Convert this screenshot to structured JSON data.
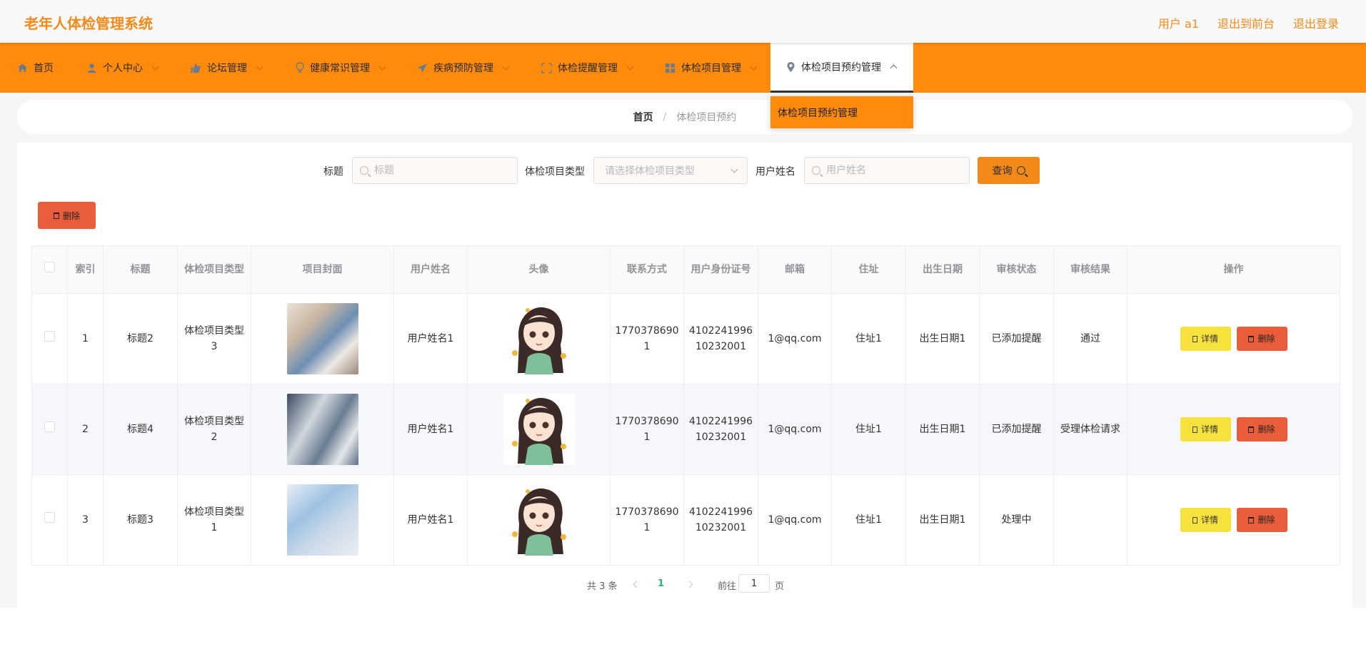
{
  "app": {
    "title": "老年人体检管理系统"
  },
  "top_links": {
    "user": "用户 a1",
    "front": "退出到前台",
    "logout": "退出登录"
  },
  "nav": {
    "items": [
      {
        "label": "首页",
        "icon": "home-icon"
      },
      {
        "label": "个人中心",
        "icon": "user-icon"
      },
      {
        "label": "论坛管理",
        "icon": "thumbs-up-icon"
      },
      {
        "label": "健康常识管理",
        "icon": "bulb-icon"
      },
      {
        "label": "疾病预防管理",
        "icon": "send-icon"
      },
      {
        "label": "体检提醒管理",
        "icon": "crop-icon"
      },
      {
        "label": "体检项目管理",
        "icon": "grid-icon"
      },
      {
        "label": "体检项目预约管理",
        "icon": "location-icon"
      }
    ],
    "dropdown_item": "体检项目预约管理"
  },
  "breadcrumb": {
    "home": "首页",
    "sep": "/",
    "current": "体检项目预约"
  },
  "search": {
    "title_label": "标题",
    "title_placeholder": "标题",
    "type_label": "体检项目类型",
    "type_placeholder": "请选择体检项目类型",
    "username_label": "用户姓名",
    "username_placeholder": "用户姓名",
    "query_button": "查询"
  },
  "toolbar": {
    "delete_button": "删除"
  },
  "table": {
    "headers": [
      "索引",
      "标题",
      "体检项目类型",
      "项目封面",
      "用户姓名",
      "头像",
      "联系方式",
      "用户身份证号",
      "邮箱",
      "住址",
      "出生日期",
      "审核状态",
      "审核结果",
      "操作"
    ],
    "rows": [
      {
        "index": "1",
        "title": "标题2",
        "type": "体检项目类型3",
        "username": "用户姓名1",
        "phone": "17703786901",
        "id_card": "410224199610232001",
        "email": "1@qq.com",
        "address": "住址1",
        "birth": "出生日期1",
        "status": "已添加提醒",
        "result": "通过",
        "detail": "详情",
        "delete": "删除"
      },
      {
        "index": "2",
        "title": "标题4",
        "type": "体检项目类型2",
        "username": "用户姓名1",
        "phone": "17703786901",
        "id_card": "410224199610232001",
        "email": "1@qq.com",
        "address": "住址1",
        "birth": "出生日期1",
        "status": "已添加提醒",
        "result": "受理体检请求",
        "detail": "详情",
        "delete": "删除"
      },
      {
        "index": "3",
        "title": "标题3",
        "type": "体检项目类型1",
        "username": "用户姓名1",
        "phone": "17703786901",
        "id_card": "410224199610232001",
        "email": "1@qq.com",
        "address": "住址1",
        "birth": "出生日期1",
        "status": "处理中",
        "result": "",
        "detail": "详情",
        "delete": "删除"
      }
    ]
  },
  "pager": {
    "total": "共 3 条",
    "page": "1",
    "goto": "前往",
    "jump_value": "1",
    "unit": "页"
  },
  "colors": {
    "accent": "#ff8b0d",
    "title": "#f28a1a",
    "danger": "#ea5d3a",
    "detail": "#f7e13c",
    "active_page": "#2eb087"
  }
}
